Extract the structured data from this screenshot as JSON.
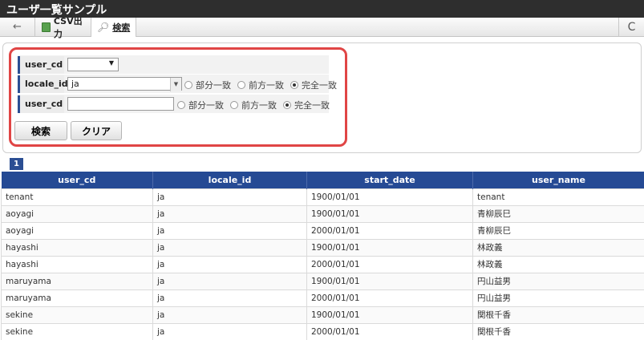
{
  "app": {
    "title": "ユーザ一覧サンプル"
  },
  "toolbar": {
    "back_icon": "←",
    "csv_label": "CSV出力",
    "search_label": "検索",
    "refresh_icon": "C"
  },
  "form": {
    "row1": {
      "label": "user_cd",
      "select_value": ""
    },
    "row2": {
      "label": "locale_id",
      "value": "ja",
      "options": [
        "部分一致",
        "前方一致",
        "完全一致"
      ],
      "selected": 2
    },
    "row3": {
      "label": "user_cd",
      "value": "",
      "options": [
        "部分一致",
        "前方一致",
        "完全一致"
      ],
      "selected": 2
    },
    "search_button": "検索",
    "clear_button": "クリア"
  },
  "pager": {
    "current": "1"
  },
  "table": {
    "columns": [
      "user_cd",
      "locale_id",
      "start_date",
      "user_name"
    ],
    "rows": [
      [
        "tenant",
        "ja",
        "1900/01/01",
        "tenant"
      ],
      [
        "aoyagi",
        "ja",
        "1900/01/01",
        "青柳辰巳"
      ],
      [
        "aoyagi",
        "ja",
        "2000/01/01",
        "青柳辰巳"
      ],
      [
        "hayashi",
        "ja",
        "1900/01/01",
        "林政義"
      ],
      [
        "hayashi",
        "ja",
        "2000/01/01",
        "林政義"
      ],
      [
        "maruyama",
        "ja",
        "1900/01/01",
        "円山益男"
      ],
      [
        "maruyama",
        "ja",
        "2000/01/01",
        "円山益男"
      ],
      [
        "sekine",
        "ja",
        "1900/01/01",
        "関根千香"
      ],
      [
        "sekine",
        "ja",
        "2000/01/01",
        "関根千香"
      ]
    ]
  },
  "colors": {
    "accent": "#254a94",
    "highlight": "#e04545",
    "titlebar": "#2e2e2e"
  }
}
